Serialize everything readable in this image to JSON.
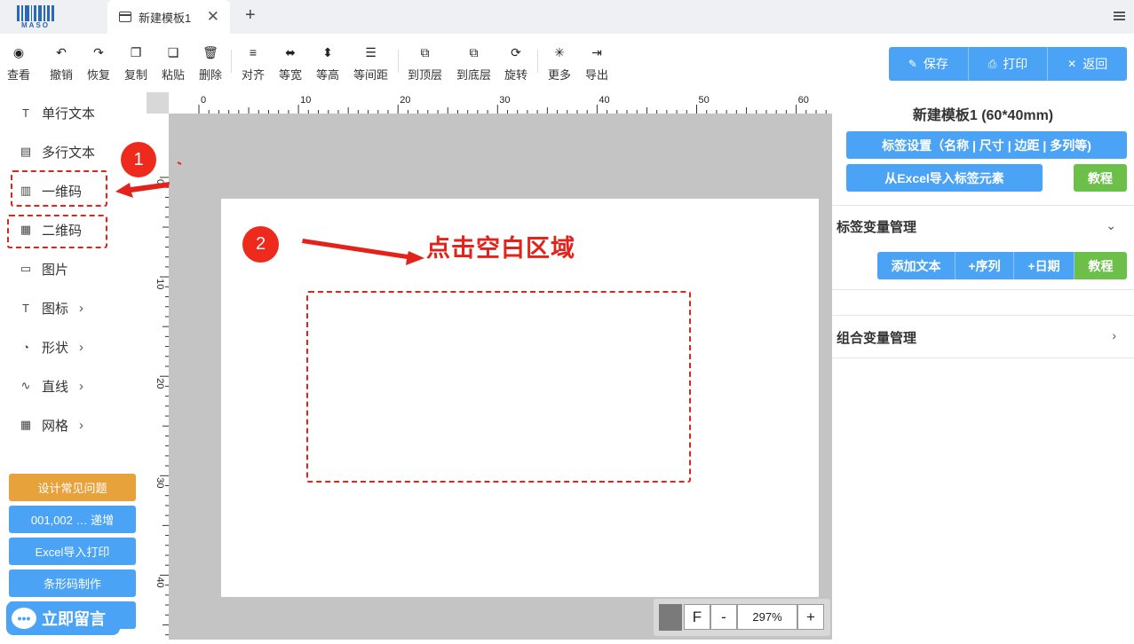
{
  "logo": {
    "text": "MASO"
  },
  "tabbar": {
    "tab_title": "新建模板1",
    "close_glyph": "✕",
    "add_glyph": "+"
  },
  "toolbar": {
    "tools": [
      {
        "id": "view",
        "label": "查看",
        "icon": "eye-icon",
        "glyph": "◉"
      },
      {
        "id": "undo",
        "label": "撤销",
        "icon": "undo-icon",
        "glyph": "↶"
      },
      {
        "id": "redo",
        "label": "恢复",
        "icon": "redo-icon",
        "glyph": "↷"
      },
      {
        "id": "copy",
        "label": "复制",
        "icon": "copy-icon",
        "glyph": "❐"
      },
      {
        "id": "paste",
        "label": "粘贴",
        "icon": "paste-icon",
        "glyph": "❏"
      },
      {
        "id": "delete",
        "label": "删除",
        "icon": "trash-icon",
        "glyph": "🗑"
      },
      {
        "id": "align",
        "label": "对齐",
        "icon": "align-icon",
        "glyph": "≡"
      },
      {
        "id": "same-width",
        "label": "等宽",
        "icon": "same-width-icon",
        "glyph": "⬌"
      },
      {
        "id": "same-height",
        "label": "等高",
        "icon": "same-height-icon",
        "glyph": "⬍"
      },
      {
        "id": "equal-spacing",
        "label": "等间距",
        "icon": "equal-spacing-icon",
        "glyph": "☰"
      },
      {
        "id": "bring-front",
        "label": "到顶层",
        "icon": "bring-front-icon",
        "glyph": "⧉"
      },
      {
        "id": "send-back",
        "label": "到底层",
        "icon": "send-back-icon",
        "glyph": "⧉"
      },
      {
        "id": "rotate",
        "label": "旋转",
        "icon": "rotate-icon",
        "glyph": "⟳"
      },
      {
        "id": "more",
        "label": "更多",
        "icon": "more-icon",
        "glyph": "✳"
      },
      {
        "id": "export",
        "label": "导出",
        "icon": "export-icon",
        "glyph": "⇥"
      }
    ],
    "actions": {
      "save": "保存",
      "print": "打印",
      "back": "返回"
    }
  },
  "sidebar": {
    "items": [
      {
        "label": "单行文本",
        "icon": "text-icon",
        "glyph": "T",
        "submenu": false
      },
      {
        "label": "多行文本",
        "icon": "multiline-text-icon",
        "glyph": "▤",
        "submenu": false
      },
      {
        "label": "一维码",
        "icon": "barcode-icon",
        "glyph": "▥",
        "submenu": false
      },
      {
        "label": "二维码",
        "icon": "qrcode-icon",
        "glyph": "▦",
        "submenu": false
      },
      {
        "label": "图片",
        "icon": "image-icon",
        "glyph": "▭",
        "submenu": false
      },
      {
        "label": "图标",
        "icon": "icon-text-icon",
        "glyph": "T",
        "submenu": true
      },
      {
        "label": "形状",
        "icon": "shape-icon",
        "glyph": "◔",
        "submenu": true
      },
      {
        "label": "直线",
        "icon": "line-icon",
        "glyph": "∿",
        "submenu": true
      },
      {
        "label": "网格",
        "icon": "grid-icon",
        "glyph": "▦",
        "submenu": true
      }
    ],
    "buttons": [
      {
        "label": "设计常见问题",
        "color": "#e8a23c"
      },
      {
        "label": "001,002 … 递增",
        "color": "#4aa3f5"
      },
      {
        "label": "Excel导入打印",
        "color": "#4aa3f5"
      },
      {
        "label": "条形码制作",
        "color": "#4aa3f5"
      }
    ],
    "chat_label": "立即留言"
  },
  "canvas": {
    "ruler_top_labels": [
      "0",
      "10",
      "20",
      "30",
      "40",
      "50",
      "60"
    ],
    "ruler_left_labels": [
      "0",
      "10",
      "20",
      "30",
      "40"
    ],
    "zoom": {
      "fit": "F",
      "minus": "-",
      "value": "297%",
      "plus": "+"
    }
  },
  "right_panel": {
    "title": "新建模板1 (60*40mm)",
    "label_settings": "标签设置（名称 | 尺寸 | 边距 | 多列等)",
    "excel_import": "从Excel导入标签元素",
    "tutorial": "教程",
    "variable_section": "标签变量管理",
    "var_buttons": [
      "添加文本",
      "+序列",
      "+日期"
    ],
    "var_tutorial": "教程",
    "combo_section": "组合变量管理"
  },
  "annotations": {
    "badge1": "1",
    "badge2": "2",
    "hint": "点击空白区域",
    "accent": "#e3231b"
  }
}
